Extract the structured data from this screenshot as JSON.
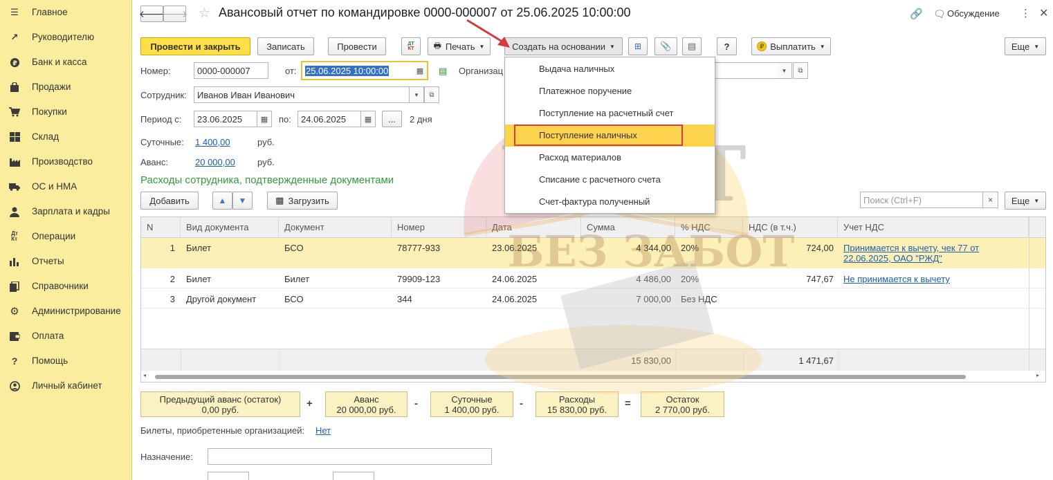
{
  "sidebar": {
    "items": [
      {
        "label": "Главное",
        "icon": "menu-icon"
      },
      {
        "label": "Руководителю",
        "icon": "trend-icon"
      },
      {
        "label": "Банк и касса",
        "icon": "ruble-coin-icon"
      },
      {
        "label": "Продажи",
        "icon": "shopping-bag-icon"
      },
      {
        "label": "Покупки",
        "icon": "cart-icon"
      },
      {
        "label": "Склад",
        "icon": "warehouse-icon"
      },
      {
        "label": "Производство",
        "icon": "factory-icon"
      },
      {
        "label": "ОС и НМА",
        "icon": "truck-icon"
      },
      {
        "label": "Зарплата и кадры",
        "icon": "person-icon"
      },
      {
        "label": "Операции",
        "icon": "dt-kt-icon"
      },
      {
        "label": "Отчеты",
        "icon": "bar-chart-icon"
      },
      {
        "label": "Справочники",
        "icon": "books-icon"
      },
      {
        "label": "Администрирование",
        "icon": "gear-icon"
      },
      {
        "label": "Оплата",
        "icon": "wallet-icon"
      },
      {
        "label": "Помощь",
        "icon": "question-icon"
      },
      {
        "label": "Личный кабинет",
        "icon": "user-circle-icon"
      }
    ]
  },
  "header": {
    "title": "Авансовый отчет по командировке 0000-000007 от 25.06.2025 10:00:00",
    "discussion": "Обсуждение"
  },
  "toolbar": {
    "post_close": "Провести и закрыть",
    "save": "Записать",
    "post": "Провести",
    "dtkt": "Дт Кт",
    "print": "Печать",
    "create_based": "Создать на основании",
    "help": "?",
    "pay": "Выплатить",
    "more": "Еще"
  },
  "form": {
    "number_label": "Номер:",
    "number_value": "0000-000007",
    "from_label": "от:",
    "date_value": "25.06.2025 10:00:00",
    "org_label": "Организац",
    "employee_label": "Сотрудник:",
    "employee_value": "Иванов Иван Иванович",
    "period_label": "Период с:",
    "period_from": "23.06.2025",
    "period_to_label": "по:",
    "period_to": "24.06.2025",
    "period_dots": "...",
    "days": "2 дня",
    "per_diem_label": "Суточные:",
    "per_diem_value": "1 400,00",
    "rub": "руб.",
    "advance_label": "Аванс:",
    "advance_value": "20 000,00"
  },
  "section_title": "Расходы сотрудника, подтвержденные документами",
  "table_toolbar": {
    "add": "Добавить",
    "load": "Загрузить",
    "search_placeholder": "Поиск (Ctrl+F)",
    "clear": "×",
    "more": "Еще"
  },
  "table": {
    "columns": [
      "N",
      "Вид документа",
      "Документ",
      "Номер",
      "Дата",
      "Сумма",
      "% НДС",
      "НДС (в т.ч.)",
      "Учет НДС"
    ],
    "rows": [
      {
        "n": "1",
        "kind": "Билет",
        "doc": "БСО",
        "number": "78777-933",
        "date": "23.06.2025",
        "sum": "4 344,00",
        "vat_rate": "20%",
        "vat": "724,00",
        "vat_acc_1": "Принимается к вычету, чек 77 от",
        "vat_acc_2": "22.06.2025, ОАО \"РЖД\""
      },
      {
        "n": "2",
        "kind": "Билет",
        "doc": "Билет",
        "number": "79909-123",
        "date": "24.06.2025",
        "sum": "4 486,00",
        "vat_rate": "20%",
        "vat": "747,67",
        "vat_acc_1": "Не принимается к вычету",
        "vat_acc_2": ""
      },
      {
        "n": "3",
        "kind": "Другой документ",
        "doc": "БСО",
        "number": "344",
        "date": "24.06.2025",
        "sum": "7 000,00",
        "vat_rate": "Без НДС",
        "vat": "",
        "vat_acc_1": "",
        "vat_acc_2": ""
      }
    ],
    "total_sum": "15 830,00",
    "total_vat": "1 471,67"
  },
  "summary": {
    "prev_label": "Предыдущий аванс (остаток)",
    "prev_value": "0,00 руб.",
    "plus": "+",
    "advance_label": "Аванс",
    "advance_value": "20 000,00 руб.",
    "minus1": "-",
    "per_diem_label": "Суточные",
    "per_diem_value": "1 400,00 руб.",
    "minus2": "-",
    "expenses_label": "Расходы",
    "expenses_value": "15 830,00 руб.",
    "equals": "=",
    "balance_label": "Остаток",
    "balance_value": "2 770,00 руб."
  },
  "footer": {
    "tickets_label": "Билеты, приобретенные организацией:",
    "tickets_value": "Нет",
    "purpose_label": "Назначение:"
  },
  "dropdown": {
    "items": [
      "Выдача наличных",
      "Платежное поручение",
      "Поступление на расчетный счет",
      "Поступление наличных",
      "Расход материалов",
      "Списание с расчетного счета",
      "Счет-фактура полученный"
    ],
    "highlighted_index": 3
  },
  "watermark": {
    "line1": "УЧЕТ",
    "line2": "БЕЗ ЗАБОТ"
  },
  "colors": {
    "sidebar_bg": "#fbed9e",
    "primary_button": "#fde047",
    "highlight_row": "#fdf0b6",
    "dropdown_highlight": "#fcd34d",
    "link": "#1a5fb4",
    "section_title": "#2e9c3a"
  }
}
